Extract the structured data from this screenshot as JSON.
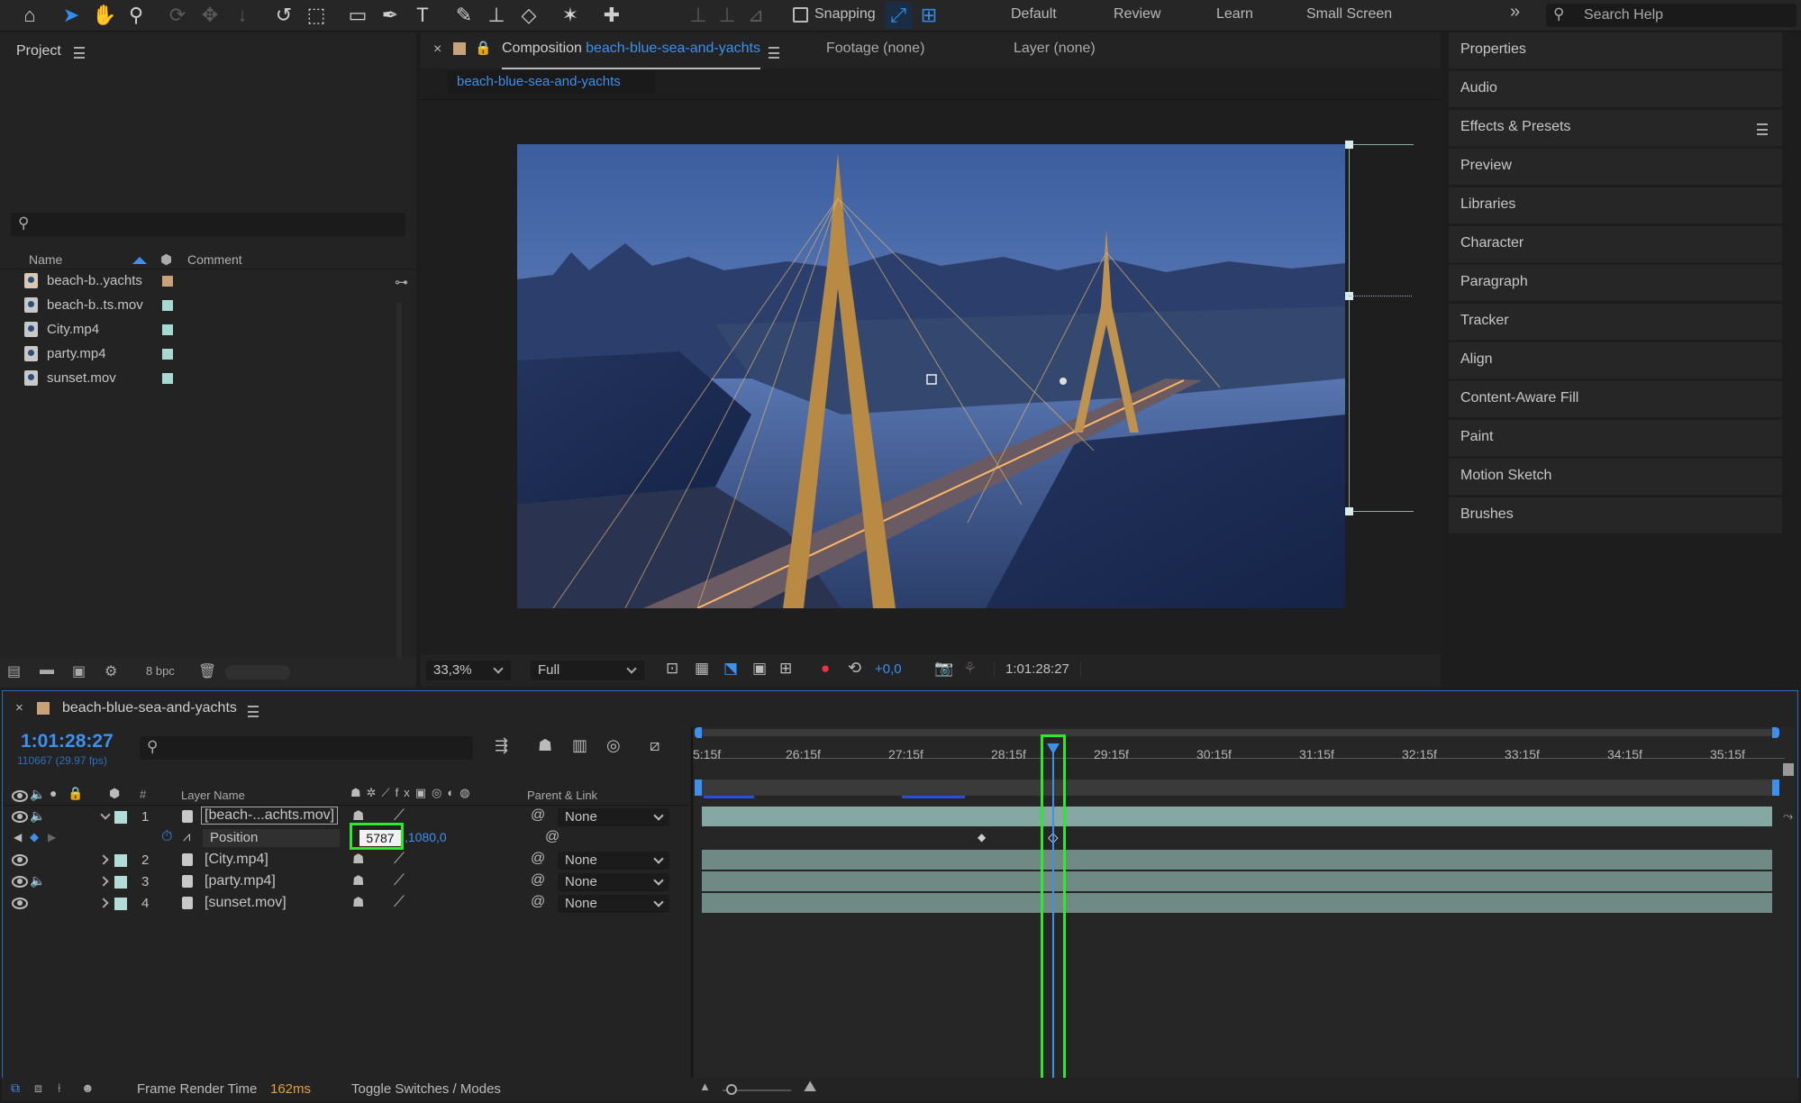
{
  "toolbar": {
    "snapping_label": "Snapping",
    "workspaces": [
      "Default",
      "Review",
      "Learn",
      "Small Screen"
    ],
    "search_placeholder": "Search Help"
  },
  "project": {
    "title": "Project",
    "columns": {
      "name": "Name",
      "comment": "Comment"
    },
    "files": [
      {
        "name": "beach-b..yachts",
        "color": "#c9a27a",
        "icon": "composition-icon"
      },
      {
        "name": "beach-b..ts.mov",
        "color": "#a8d8d2",
        "icon": "footage-icon"
      },
      {
        "name": "City.mp4",
        "color": "#a8d8d2",
        "icon": "footage-icon"
      },
      {
        "name": "party.mp4",
        "color": "#a8d8d2",
        "icon": "footage-icon"
      },
      {
        "name": "sunset.mov",
        "color": "#a8d8d2",
        "icon": "footage-icon"
      }
    ],
    "bpc": "8 bpc"
  },
  "viewer": {
    "composition_prefix": "Composition",
    "composition_name": "beach-blue-sea-and-yachts",
    "footage_tab": "Footage (none)",
    "layer_tab": "Layer (none)",
    "sub_tab": "beach-blue-sea-and-yachts",
    "zoom": "33,3%",
    "resolution": "Full",
    "exposure": "+0,0",
    "timecode": "1:01:28:27"
  },
  "right_panel": {
    "items": [
      "Properties",
      "Audio",
      "Effects & Presets",
      "Preview",
      "Libraries",
      "Character",
      "Paragraph",
      "Tracker",
      "Align",
      "Content-Aware Fill",
      "Paint",
      "Motion Sketch",
      "Brushes"
    ]
  },
  "timeline": {
    "comp_name": "beach-blue-sea-and-yachts",
    "current_time": "1:01:28:27",
    "frame_info": "110667 (29.97 fps)",
    "columns": {
      "num": "#",
      "layer_name": "Layer Name",
      "parent": "Parent & Link"
    },
    "layers": [
      {
        "num": "1",
        "name": "[beach-...achts.mov]",
        "parent": "None"
      },
      {
        "num": "2",
        "name": "[City.mp4]",
        "parent": "None"
      },
      {
        "num": "3",
        "name": "[party.mp4]",
        "parent": "None"
      },
      {
        "num": "4",
        "name": "[sunset.mov]",
        "parent": "None"
      }
    ],
    "property": {
      "name": "Position",
      "value_x": "5787",
      "value_y": ",1080,0"
    },
    "ruler": [
      "5:15f",
      "26:15f",
      "27:15f",
      "28:15f",
      "29:15f",
      "30:15f",
      "31:15f",
      "32:15f",
      "33:15f",
      "34:15f",
      "35:15f"
    ],
    "footer": {
      "render_label": "Frame Render Time",
      "render_value": "162ms",
      "toggle": "Toggle Switches / Modes"
    }
  }
}
